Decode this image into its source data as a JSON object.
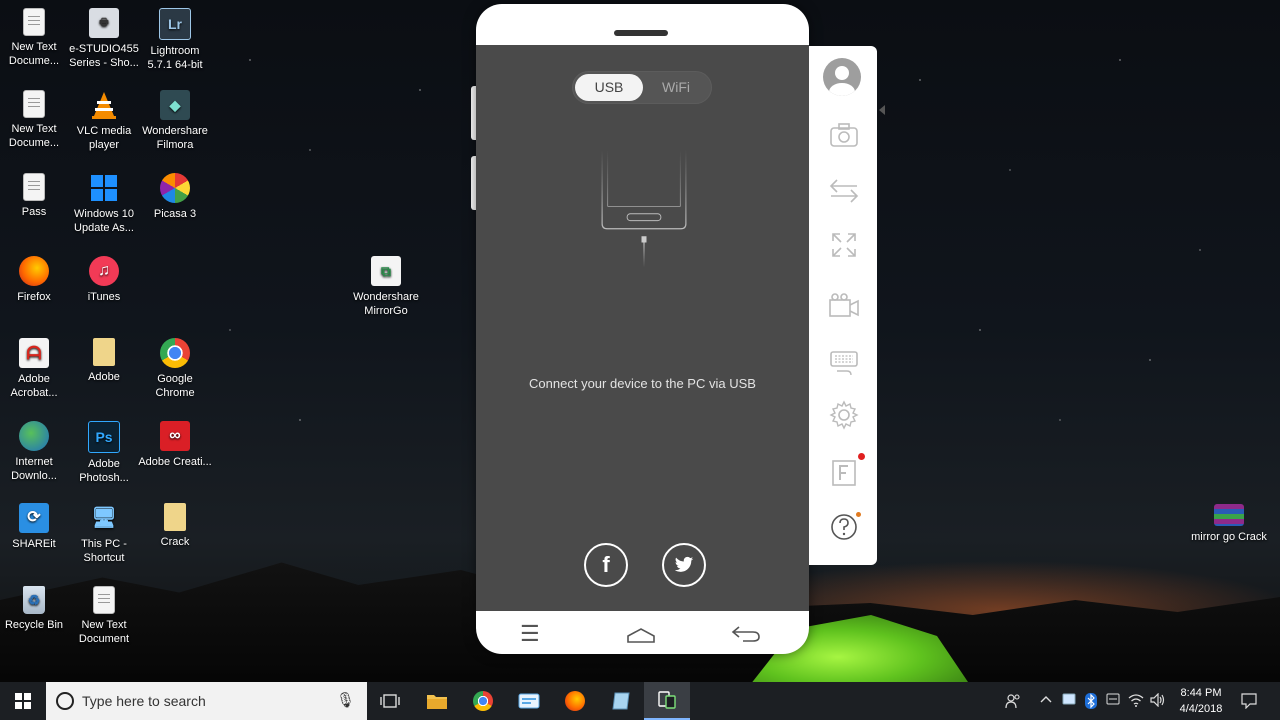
{
  "desktop": {
    "icons": [
      {
        "label": "New Text Docume...",
        "icon": "text-document-icon"
      },
      {
        "label": "e-STUDIO455 Series - Sho...",
        "icon": "printer-icon"
      },
      {
        "label": "Lightroom 5.7.1 64-bit",
        "icon": "lightroom-icon"
      },
      {
        "label": "New Text Docume...",
        "icon": "text-document-icon"
      },
      {
        "label": "VLC media player",
        "icon": "vlc-icon"
      },
      {
        "label": "Wondershare Filmora",
        "icon": "filmora-icon"
      },
      {
        "label": "Pass",
        "icon": "text-document-icon"
      },
      {
        "label": "Windows 10 Update As...",
        "icon": "windows-update-icon"
      },
      {
        "label": "Picasa 3",
        "icon": "picasa-icon"
      },
      {
        "label": "Firefox",
        "icon": "firefox-icon"
      },
      {
        "label": "iTunes",
        "icon": "itunes-icon"
      },
      {
        "label": "Wondershare MirrorGo",
        "icon": "mirrorgo-icon"
      },
      {
        "label": "Adobe Acrobat...",
        "icon": "acrobat-icon"
      },
      {
        "label": "Adobe",
        "icon": "folder-icon"
      },
      {
        "label": "Google Chrome",
        "icon": "chrome-icon"
      },
      {
        "label": "Internet Downlo...",
        "icon": "idm-icon"
      },
      {
        "label": "Adobe Photosh...",
        "icon": "photoshop-icon"
      },
      {
        "label": "Adobe Creati...",
        "icon": "creative-cloud-icon"
      },
      {
        "label": "SHAREit",
        "icon": "shareit-icon"
      },
      {
        "label": "This PC - Shortcut",
        "icon": "this-pc-icon"
      },
      {
        "label": "Crack",
        "icon": "folder-icon"
      },
      {
        "label": "Recycle Bin",
        "icon": "recycle-bin-icon"
      },
      {
        "label": "New Text Document",
        "icon": "text-document-icon"
      },
      {
        "label": "mirror go Crack",
        "icon": "winrar-icon"
      }
    ]
  },
  "mirrorgo": {
    "toggle": {
      "usb": "USB",
      "wifi": "WiFi",
      "selected": "USB"
    },
    "connect_message": "Connect your device to the PC via USB",
    "social": [
      "facebook-icon",
      "twitter-icon"
    ],
    "nav": [
      "menu-icon",
      "home-icon",
      "back-icon"
    ],
    "sidebar": [
      "avatar-icon",
      "camera-icon",
      "transfer-icon",
      "fullscreen-icon",
      "video-record-icon",
      "keyboard-icon",
      "settings-icon",
      "feedback-icon",
      "help-icon"
    ]
  },
  "taskbar": {
    "search_placeholder": "Type here to search",
    "apps": [
      "task-view-icon",
      "file-explorer-icon",
      "chrome-icon",
      "app-icon",
      "firefox-icon",
      "notepad-icon",
      "mirrorgo-icon"
    ],
    "time": "8:44 PM",
    "date": "4/4/2018"
  }
}
